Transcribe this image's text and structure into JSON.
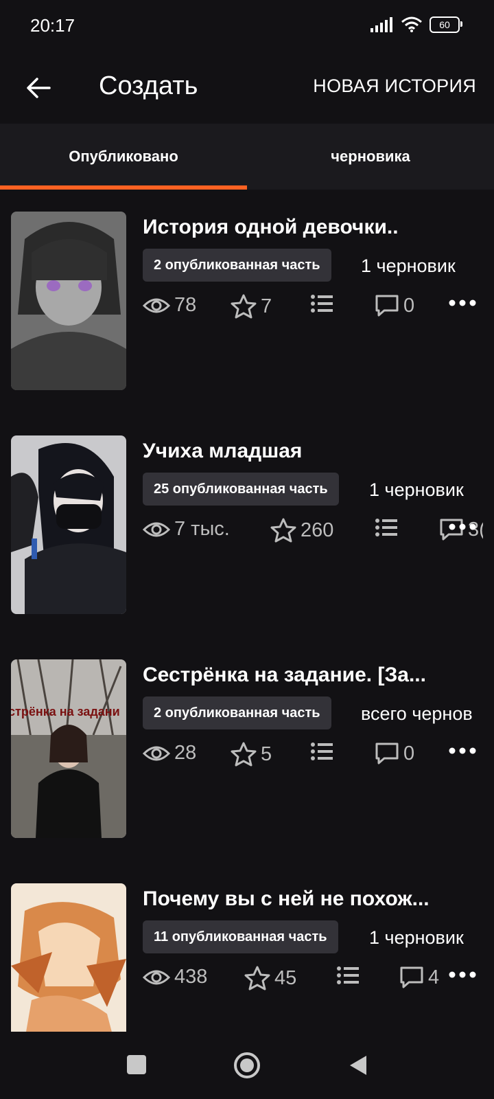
{
  "status": {
    "time": "20:17",
    "battery": "60"
  },
  "header": {
    "title": "Создать",
    "action_label": "НОВАЯ ИСТОРИЯ"
  },
  "tabs": [
    {
      "label": "Опубликовано",
      "active": true
    },
    {
      "label": "черновика",
      "active": false
    }
  ],
  "stories": [
    {
      "title": "История одной девочки..",
      "published": "2 опубликованная часть",
      "drafts": "1 черновик",
      "views": "78",
      "votes": "7",
      "comments": "0"
    },
    {
      "title": "Учиха младшая",
      "published": "25 опубликованная часть",
      "drafts": "1 черновик",
      "views": "7 тыс.",
      "votes": "260",
      "comments": "3("
    },
    {
      "title": "Сестрёнка на задание. [За...",
      "published": "2 опубликованная часть",
      "drafts": "всего чернов",
      "views": "28",
      "votes": "5",
      "comments": "0",
      "cover_text": "стрёнка на задани"
    },
    {
      "title": "Почему вы с ней не похож...",
      "published": "11 опубликованная часть",
      "drafts": "1 черновик",
      "views": "438",
      "votes": "45",
      "comments": "4"
    }
  ],
  "colors": {
    "accent": "#ff6122",
    "background": "#121114",
    "badge": "#333238"
  },
  "icons": [
    "back-arrow-icon",
    "eye-icon",
    "star-icon",
    "list-icon",
    "comment-icon",
    "more-dots-icon",
    "nav-square-icon",
    "nav-circle-icon",
    "nav-back-triangle-icon"
  ]
}
